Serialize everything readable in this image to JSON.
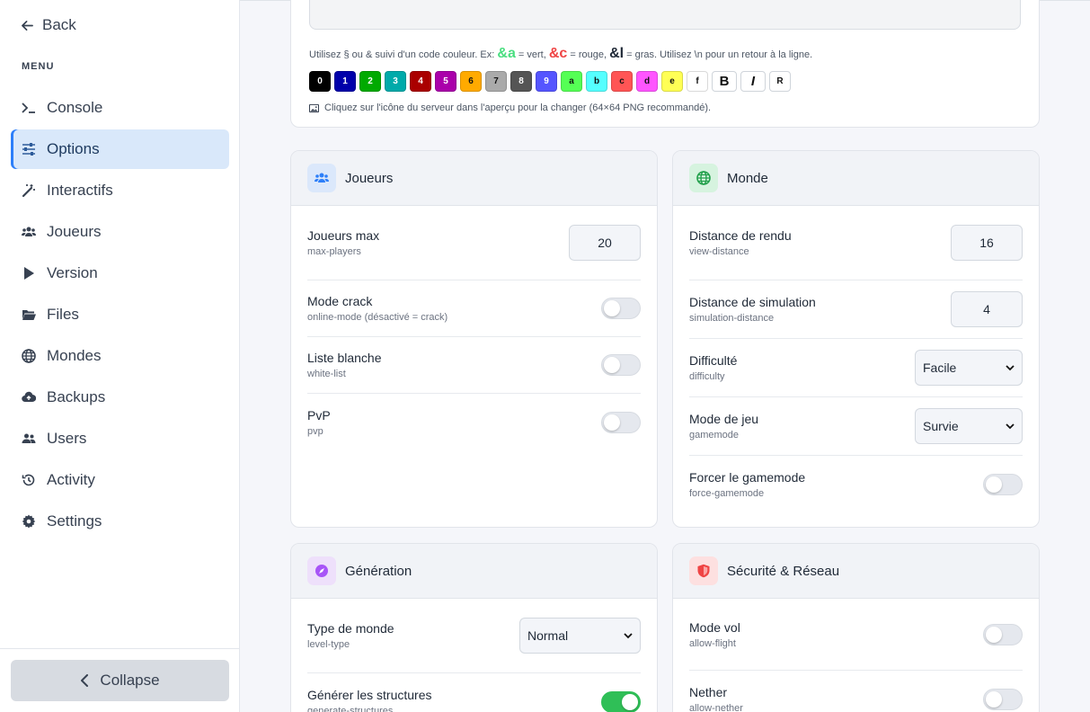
{
  "sidebar": {
    "back_label": "Back",
    "menu_title": "MENU",
    "items": [
      {
        "label": "Console",
        "icon": "terminal-icon"
      },
      {
        "label": "Options",
        "icon": "sliders-icon"
      },
      {
        "label": "Interactifs",
        "icon": "magic-wand-icon"
      },
      {
        "label": "Joueurs",
        "icon": "users-icon"
      },
      {
        "label": "Version",
        "icon": "play-icon"
      },
      {
        "label": "Files",
        "icon": "folder-icon"
      },
      {
        "label": "Mondes",
        "icon": "globe-icon"
      },
      {
        "label": "Backups",
        "icon": "cloud-upload-icon"
      },
      {
        "label": "Users",
        "icon": "user-group-icon"
      },
      {
        "label": "Activity",
        "icon": "history-icon"
      },
      {
        "label": "Settings",
        "icon": "gear-icon"
      }
    ],
    "active": "Options",
    "collapse_label": "Collapse"
  },
  "motd": {
    "help_prefix": "Utilisez § ou & suivi d'un code couleur. Ex: ",
    "code_a": "&a",
    "text_a": " = vert, ",
    "code_c": "&c",
    "text_c": " = rouge, ",
    "code_l": "&l",
    "help_suffix": " = gras. Utilisez \\n pour un retour à la ligne.",
    "colors": [
      {
        "code": "0",
        "bg": "#000000",
        "fg": "#ffffff"
      },
      {
        "code": "1",
        "bg": "#0000aa",
        "fg": "#ffffff"
      },
      {
        "code": "2",
        "bg": "#00aa00",
        "fg": "#ffffff"
      },
      {
        "code": "3",
        "bg": "#00aaaa",
        "fg": "#ffffff"
      },
      {
        "code": "4",
        "bg": "#aa0000",
        "fg": "#ffffff"
      },
      {
        "code": "5",
        "bg": "#aa00aa",
        "fg": "#ffffff"
      },
      {
        "code": "6",
        "bg": "#ffaa00",
        "fg": "#111111"
      },
      {
        "code": "7",
        "bg": "#aaaaaa",
        "fg": "#111111"
      },
      {
        "code": "8",
        "bg": "#555555",
        "fg": "#ffffff"
      },
      {
        "code": "9",
        "bg": "#5555ff",
        "fg": "#ffffff"
      },
      {
        "code": "a",
        "bg": "#55ff55",
        "fg": "#111111"
      },
      {
        "code": "b",
        "bg": "#55ffff",
        "fg": "#111111"
      },
      {
        "code": "c",
        "bg": "#ff5555",
        "fg": "#111111"
      },
      {
        "code": "d",
        "bg": "#ff55ff",
        "fg": "#111111"
      },
      {
        "code": "e",
        "bg": "#ffff55",
        "fg": "#111111"
      },
      {
        "code": "f",
        "bg": "#ffffff",
        "fg": "#111111"
      }
    ],
    "format_bold": "B",
    "format_italic": "I",
    "format_reset": "R",
    "icon_hint": "Cliquez sur l'icône du serveur dans l'aperçu pour la changer (64×64 PNG recommandé)."
  },
  "joueurs": {
    "title": "Joueurs",
    "max_players": {
      "name": "Joueurs max",
      "key": "max-players",
      "value": "20"
    },
    "online_mode": {
      "name": "Mode crack",
      "key": "online-mode (désactivé = crack)"
    },
    "white_list": {
      "name": "Liste blanche",
      "key": "white-list"
    },
    "pvp": {
      "name": "PvP",
      "key": "pvp"
    }
  },
  "monde": {
    "title": "Monde",
    "view_distance": {
      "name": "Distance de rendu",
      "key": "view-distance",
      "value": "16"
    },
    "simulation_distance": {
      "name": "Distance de simulation",
      "key": "simulation-distance",
      "value": "4"
    },
    "difficulty": {
      "name": "Difficulté",
      "key": "difficulty",
      "value": "Facile"
    },
    "gamemode": {
      "name": "Mode de jeu",
      "key": "gamemode",
      "value": "Survie"
    },
    "force_gamemode": {
      "name": "Forcer le gamemode",
      "key": "force-gamemode"
    }
  },
  "generation": {
    "title": "Génération",
    "level_type": {
      "name": "Type de monde",
      "key": "level-type",
      "value": "Normal"
    },
    "generate_structures": {
      "name": "Générer les structures",
      "key": "generate-structures"
    }
  },
  "securite": {
    "title": "Sécurité & Réseau",
    "allow_flight": {
      "name": "Mode vol",
      "key": "allow-flight"
    },
    "allow_nether": {
      "name": "Nether",
      "key": "allow-nether"
    }
  },
  "colors": {
    "accent": "#2d7ff9",
    "toggle_on": "#2fbf57",
    "joueurs_badge": "#dbe8fb",
    "monde_badge": "#d6f3df",
    "generation_badge": "#eee0fb",
    "securite_badge": "#fde0e0"
  }
}
